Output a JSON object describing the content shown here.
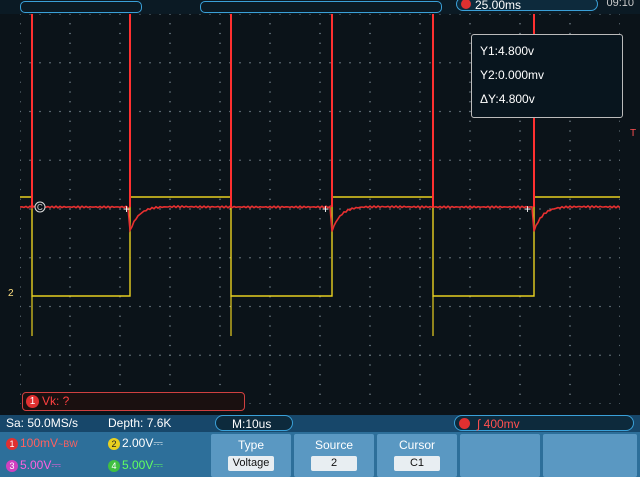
{
  "top": {
    "timebase": "25.00ms",
    "clock": "09:10"
  },
  "cursor_readout": {
    "y1": "Y1:4.800v",
    "y2": "Y2:0.000mv",
    "dy": "ΔY:4.800v"
  },
  "markers": {
    "ch2_level": "2",
    "trigger_right": "T",
    "ch1_circle": "C"
  },
  "math": {
    "channel": "1",
    "label": "Vk:  ?"
  },
  "status": {
    "sample_rate": "Sa: 50.0MS/s",
    "depth": "Depth: 7.6K",
    "horizontal": "M:10us",
    "trigger_channel": "1",
    "trigger_level": "400mv"
  },
  "channels": [
    {
      "num": "1",
      "scale": "100mV",
      "extra": "~BW",
      "color": "#e03030"
    },
    {
      "num": "2",
      "scale": "2.00V",
      "extra": "⎓",
      "color": "#e8d020"
    },
    {
      "num": "3",
      "scale": "5.00V",
      "extra": "⎓",
      "color": "#d040c0"
    },
    {
      "num": "4",
      "scale": "5.00V",
      "extra": "⎓",
      "color": "#40c040"
    }
  ],
  "softkeys": [
    {
      "label": "Type",
      "value": "Voltage"
    },
    {
      "label": "Source",
      "value": "2"
    },
    {
      "label": "Cursor",
      "value": "C1"
    }
  ],
  "colors": {
    "trace_ch1": "#e83030",
    "trace_ch2": "#e8d020",
    "accent": "#3aa0d8"
  }
}
